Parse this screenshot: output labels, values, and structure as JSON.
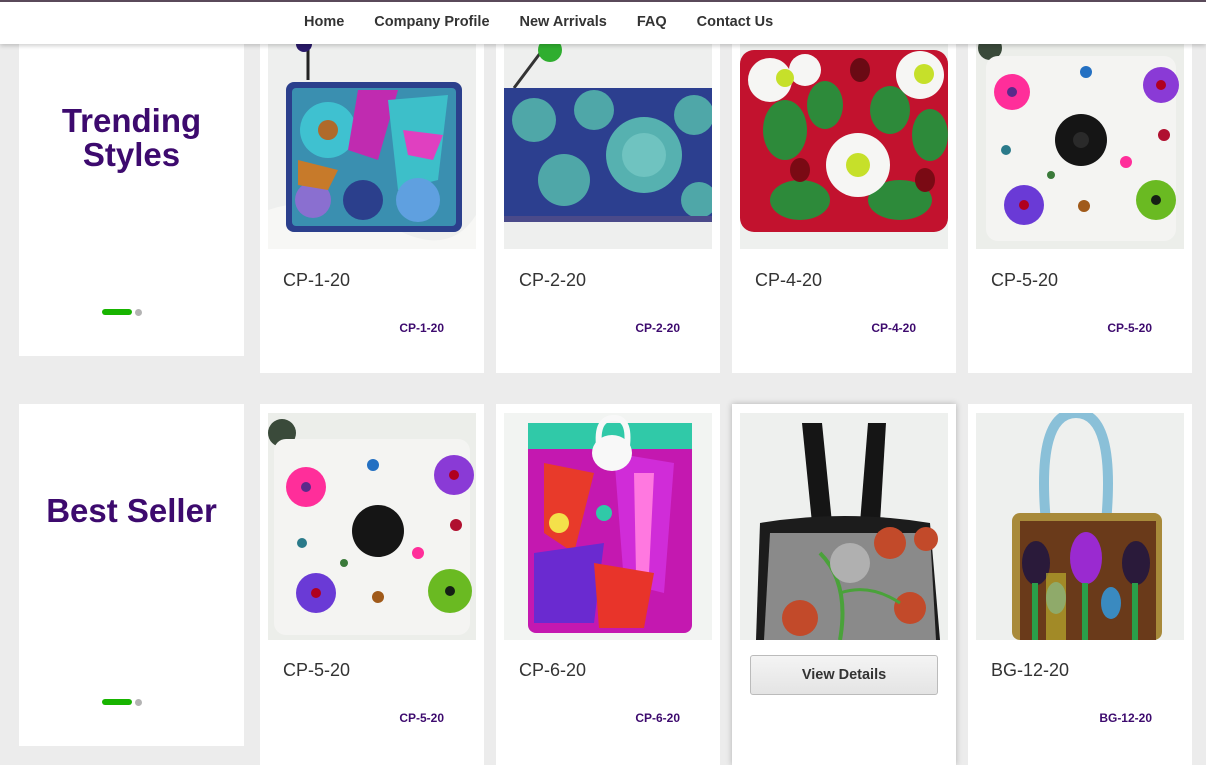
{
  "nav": {
    "items": [
      "Home",
      "Company Profile",
      "New Arrivals",
      "FAQ",
      "Contact Us"
    ]
  },
  "sections": [
    {
      "title": "Trending Styles",
      "products": [
        {
          "name": "CP-1-20",
          "code": "CP-1-20",
          "image": "blue-floral-felt-pouch"
        },
        {
          "name": "CP-2-20",
          "code": "CP-2-20",
          "image": "teal-floral-pencil-pouch"
        },
        {
          "name": "CP-4-20",
          "code": "CP-4-20",
          "image": "red-daisy-ladybug-pouch"
        },
        {
          "name": "CP-5-20",
          "code": "CP-5-20",
          "image": "white-polka-dot-felt-pouch"
        }
      ]
    },
    {
      "title": "Best Seller",
      "products": [
        {
          "name": "CP-5-20",
          "code": "CP-5-20",
          "image": "white-polka-dot-felt-pouch"
        },
        {
          "name": "CP-6-20",
          "code": "CP-6-20",
          "image": "pink-purple-button-pouch"
        },
        {
          "name": "",
          "code": "",
          "image": "black-floral-handbag",
          "button": "View Details"
        },
        {
          "name": "BG-12-20",
          "code": "BG-12-20",
          "image": "tan-flower-tote-bag"
        }
      ]
    }
  ],
  "colors": {
    "brand_purple": "#3d0a6e",
    "dot_active": "#18b400",
    "page_bg": "#ececec"
  }
}
